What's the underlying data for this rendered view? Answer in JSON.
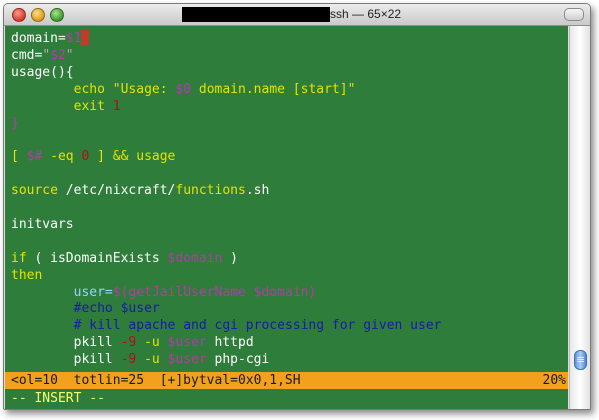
{
  "window": {
    "title": "ssh — 65×22"
  },
  "editor": {
    "lines": [
      {
        "segments": [
          [
            "plain",
            "domain="
          ],
          [
            "var",
            "$1"
          ]
        ],
        "cursor": true
      },
      {
        "segments": [
          [
            "plain",
            "cmd="
          ],
          [
            "str",
            "\""
          ],
          [
            "var",
            "$2"
          ],
          [
            "str",
            "\""
          ]
        ]
      },
      {
        "segments": [
          [
            "plain",
            "usage(){"
          ]
        ]
      },
      {
        "segments": [
          [
            "plain",
            "        "
          ],
          [
            "kw",
            "echo"
          ],
          [
            "plain",
            " "
          ],
          [
            "kw",
            "\"Usage: "
          ],
          [
            "var",
            "$0"
          ],
          [
            "kw",
            " domain.name [start]\""
          ]
        ]
      },
      {
        "segments": [
          [
            "plain",
            "        "
          ],
          [
            "kw",
            "exit"
          ],
          [
            "plain",
            " "
          ],
          [
            "num",
            "1"
          ]
        ]
      },
      {
        "segments": [
          [
            "var",
            "}"
          ]
        ]
      },
      {
        "segments": []
      },
      {
        "segments": [
          [
            "kw",
            "["
          ],
          [
            "plain",
            " "
          ],
          [
            "var",
            "$#"
          ],
          [
            "plain",
            " "
          ],
          [
            "kw",
            "-eq"
          ],
          [
            "plain",
            " "
          ],
          [
            "num",
            "0"
          ],
          [
            "plain",
            " "
          ],
          [
            "kw",
            "]"
          ],
          [
            "plain",
            " "
          ],
          [
            "kw",
            "&&"
          ],
          [
            "plain",
            " "
          ],
          [
            "kw",
            "usage"
          ]
        ]
      },
      {
        "segments": []
      },
      {
        "segments": [
          [
            "kw",
            "source"
          ],
          [
            "plain",
            " /etc/nixcraft/"
          ],
          [
            "kw",
            "functions"
          ],
          [
            "plain",
            ".sh"
          ]
        ]
      },
      {
        "segments": []
      },
      {
        "segments": [
          [
            "plain",
            "initvars"
          ]
        ]
      },
      {
        "segments": []
      },
      {
        "segments": [
          [
            "kw",
            "if"
          ],
          [
            "plain",
            " ( isDomainExists "
          ],
          [
            "var",
            "$domain"
          ],
          [
            "plain",
            " )"
          ]
        ]
      },
      {
        "segments": [
          [
            "kw",
            "then"
          ]
        ]
      },
      {
        "segments": [
          [
            "plain",
            "        "
          ],
          [
            "fn",
            "user="
          ],
          [
            "var",
            "$("
          ],
          [
            "var",
            "getJailUserName"
          ],
          [
            "plain",
            " "
          ],
          [
            "var",
            "$domain"
          ],
          [
            "var",
            ")"
          ]
        ]
      },
      {
        "segments": [
          [
            "plain",
            "        "
          ],
          [
            "cmt",
            "#echo $user"
          ]
        ]
      },
      {
        "segments": [
          [
            "plain",
            "        "
          ],
          [
            "cmt",
            "# kill apache and cgi processing for given user"
          ]
        ]
      },
      {
        "segments": [
          [
            "plain",
            "        pkill "
          ],
          [
            "num",
            "-9"
          ],
          [
            "plain",
            " "
          ],
          [
            "kw",
            "-u"
          ],
          [
            "plain",
            " "
          ],
          [
            "var",
            "$user"
          ],
          [
            "plain",
            " httpd"
          ]
        ]
      },
      {
        "segments": [
          [
            "plain",
            "        pkill "
          ],
          [
            "num",
            "-9"
          ],
          [
            "plain",
            " "
          ],
          [
            "kw",
            "-u"
          ],
          [
            "plain",
            " "
          ],
          [
            "var",
            "$user"
          ],
          [
            "plain",
            " php-cgi"
          ]
        ]
      }
    ]
  },
  "status": {
    "left": "<ol=10  totlin=25  [+]bytval=0x0,1,SH",
    "right": "20%"
  },
  "mode": {
    "text": "-- INSERT --"
  },
  "colors": {
    "terminal_bg": "#2e7d3a",
    "status_bg": "#f2a11c",
    "mode_fg": "#ffff66"
  }
}
